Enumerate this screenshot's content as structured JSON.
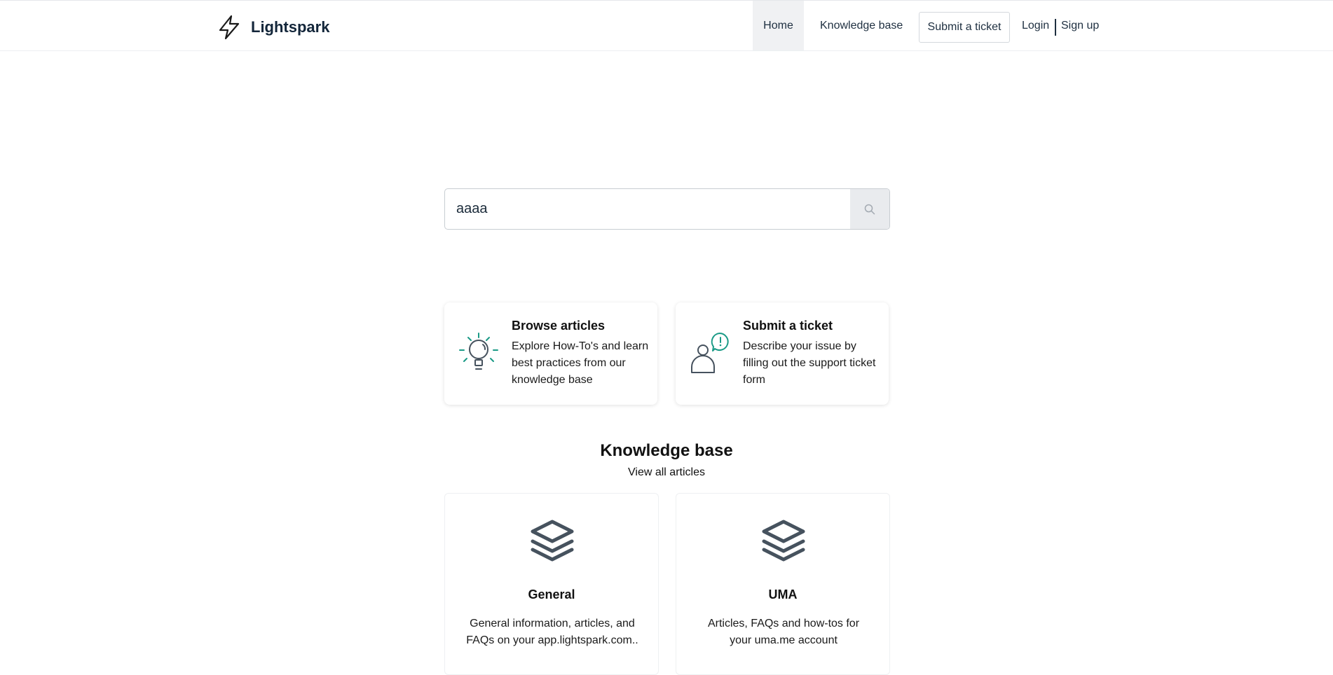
{
  "header": {
    "brand": "Lightspark",
    "nav": {
      "home": "Home",
      "knowledge_base": "Knowledge base",
      "submit_ticket": "Submit a ticket",
      "login": "Login",
      "signup": "Sign up"
    }
  },
  "search": {
    "value": "aaaa"
  },
  "action_cards": [
    {
      "title": "Browse articles",
      "description": "Explore How-To's and learn best practices from our knowledge base",
      "icon": "lightbulb-icon"
    },
    {
      "title": "Submit a ticket",
      "description": "Describe your issue by filling out the support ticket form",
      "icon": "person-alert-icon"
    }
  ],
  "knowledge_base": {
    "title": "Knowledge base",
    "view_all": "View all articles",
    "categories": [
      {
        "title": "General",
        "description": "General information, articles, and FAQs on your app.lightspark.com..",
        "icon": "layers-icon"
      },
      {
        "title": "UMA",
        "description": "Articles, FAQs and how-tos for your uma.me account",
        "icon": "layers-icon"
      }
    ]
  },
  "colors": {
    "accent_teal": "#1a9a86",
    "icon_dark": "#46525e",
    "text_dark": "#13263a"
  }
}
